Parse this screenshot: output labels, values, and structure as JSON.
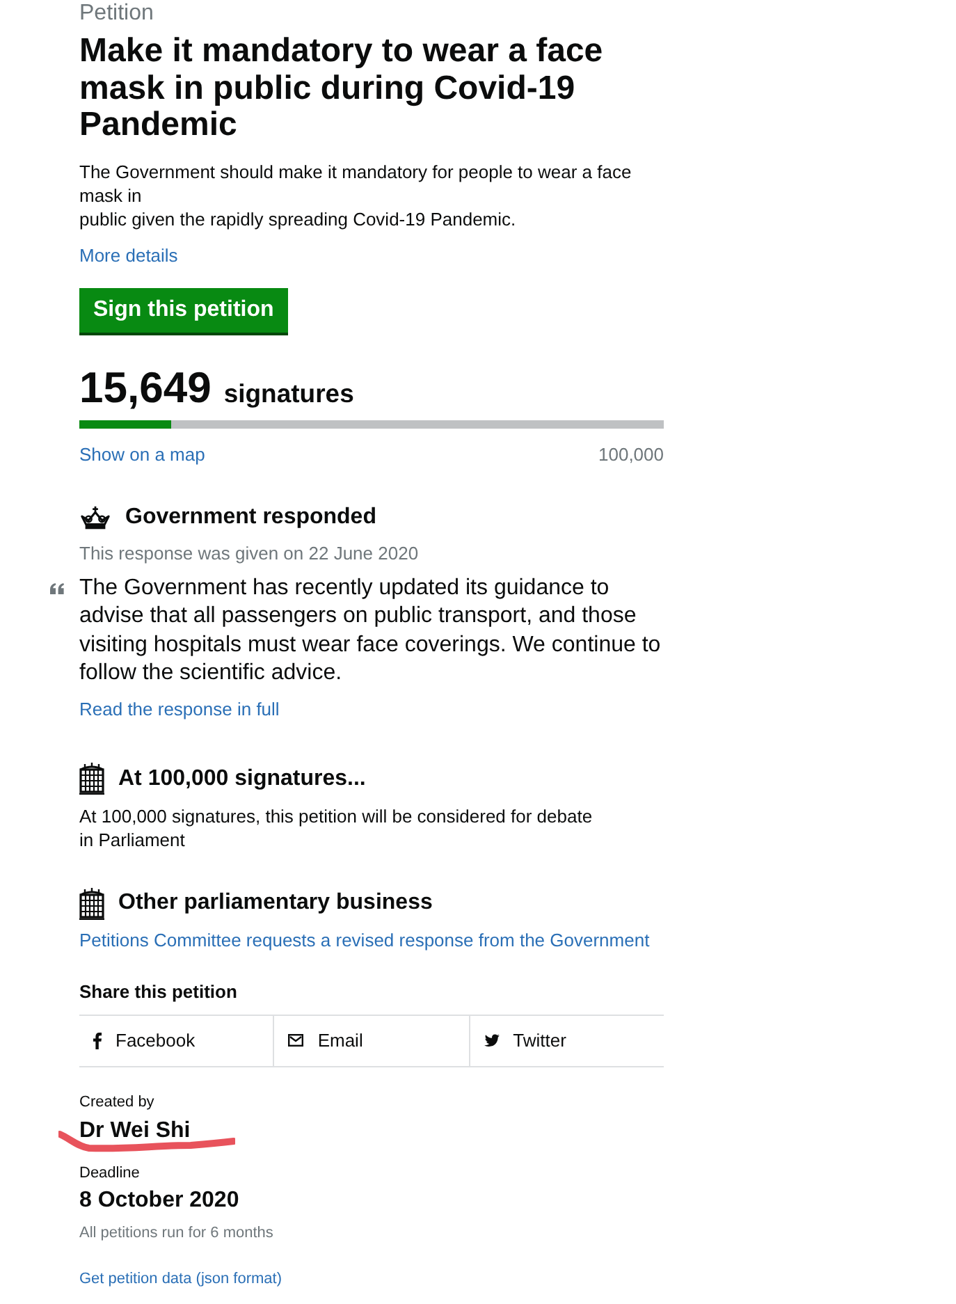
{
  "petition": {
    "kicker": "Petition",
    "title": "Make it mandatory to wear a face mask in public during Covid-19 Pandemic",
    "description_lines": [
      "The Government should make it mandatory for people to wear a face mask in",
      "public given the rapidly spreading Covid-19 Pandemic."
    ],
    "more_details": "More details"
  },
  "sign_button": "Sign this petition",
  "signatures": {
    "count": "15,649",
    "label": "signatures",
    "level": 0.156,
    "map_link": "Show on a map",
    "target": "100,000"
  },
  "sections": [
    {
      "kind": "response",
      "heading": "Government responded",
      "date_note": "This response was given on 22 June 2020",
      "quote": "The Government has recently updated its guidance to advise that all passengers on public transport, and those visiting hospitals must wear face coverings. We continue to follow the scientific advice.",
      "link": "Read the response in full"
    },
    {
      "kind": "threshold",
      "heading": "At 100,000 signatures...",
      "lines": [
        "At 100,000 signatures, this petition will be considered for debate",
        "in Parliament"
      ]
    },
    {
      "kind": "business",
      "heading": "Other parliamentary business",
      "link": "Petitions Committee requests a revised response from the Government"
    }
  ],
  "share": {
    "heading": "Share this petition",
    "items": [
      {
        "kind": "facebook",
        "label": "Facebook"
      },
      {
        "kind": "email",
        "label": "Email"
      },
      {
        "kind": "twitter",
        "label": "Twitter"
      }
    ]
  },
  "creator": {
    "label": "Created by",
    "name": "Dr Wei Shi",
    "underlined": true
  },
  "deadline": {
    "label": "Deadline",
    "date": "8 October 2020",
    "note": "All petitions run for 6 months"
  },
  "data_link": "Get petition data (json format)"
}
